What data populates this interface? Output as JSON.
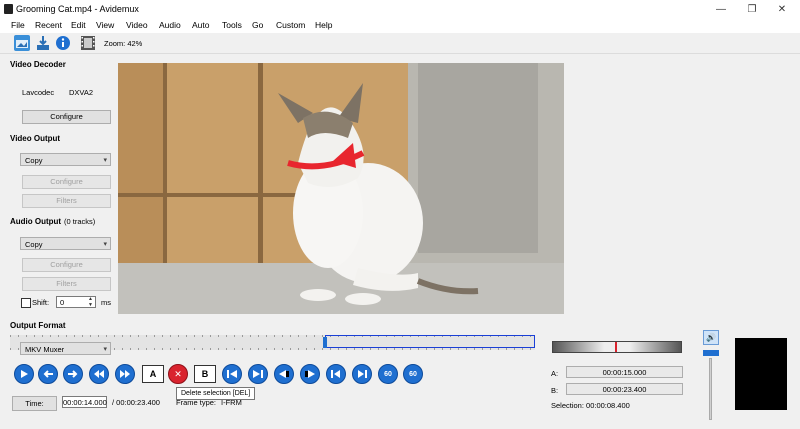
{
  "window": {
    "title": "Grooming Cat.mp4 - Avidemux",
    "minimize": "—",
    "maximize": "❐",
    "close": "✕"
  },
  "menu": [
    "File",
    "Recent",
    "Edit",
    "View",
    "Video",
    "Audio",
    "Auto",
    "Tools",
    "Go",
    "Custom",
    "Help"
  ],
  "toolbar": {
    "zoom_label": "Zoom: 42%"
  },
  "video_decoder": {
    "label": "Video Decoder",
    "lavcodec": "Lavcodec",
    "dxva": "DXVA2",
    "configure": "Configure"
  },
  "video_output": {
    "label": "Video Output",
    "codec": "Copy",
    "configure": "Configure",
    "filters": "Filters"
  },
  "audio_output": {
    "label": "Audio Output",
    "tracks": "(0 tracks)",
    "codec": "Copy",
    "configure": "Configure",
    "filters": "Filters"
  },
  "shift": {
    "label": "Shift:",
    "value": "0",
    "unit": "ms"
  },
  "output_format": {
    "label": "Output Format",
    "muxer": "MKV Muxer"
  },
  "timeline": {
    "position_fraction": 0.6,
    "selection_start_fraction": 0.6,
    "selection_end_fraction": 1.0
  },
  "controls": {
    "marker_a": "A",
    "marker_b": "B",
    "delete_glyph": "✕",
    "delete_tooltip": "Delete selection [DEL]",
    "seek_60_back": "60",
    "seek_60_forward": "60"
  },
  "time": {
    "button": "Time:",
    "current": "00:00:14.000",
    "total": "/ 00:00:23.400",
    "frame_type_label": "Frame type:",
    "frame_type": "I-FRM"
  },
  "selection": {
    "a_label": "A:",
    "a_value": "00:00:15.000",
    "b_label": "B:",
    "b_value": "00:00:23.400",
    "summary": "Selection: 00:00:08.400"
  },
  "colors": {
    "accent": "#1f6fd0",
    "delete": "#d9232e",
    "selection_outline": "#1a3fd6"
  }
}
